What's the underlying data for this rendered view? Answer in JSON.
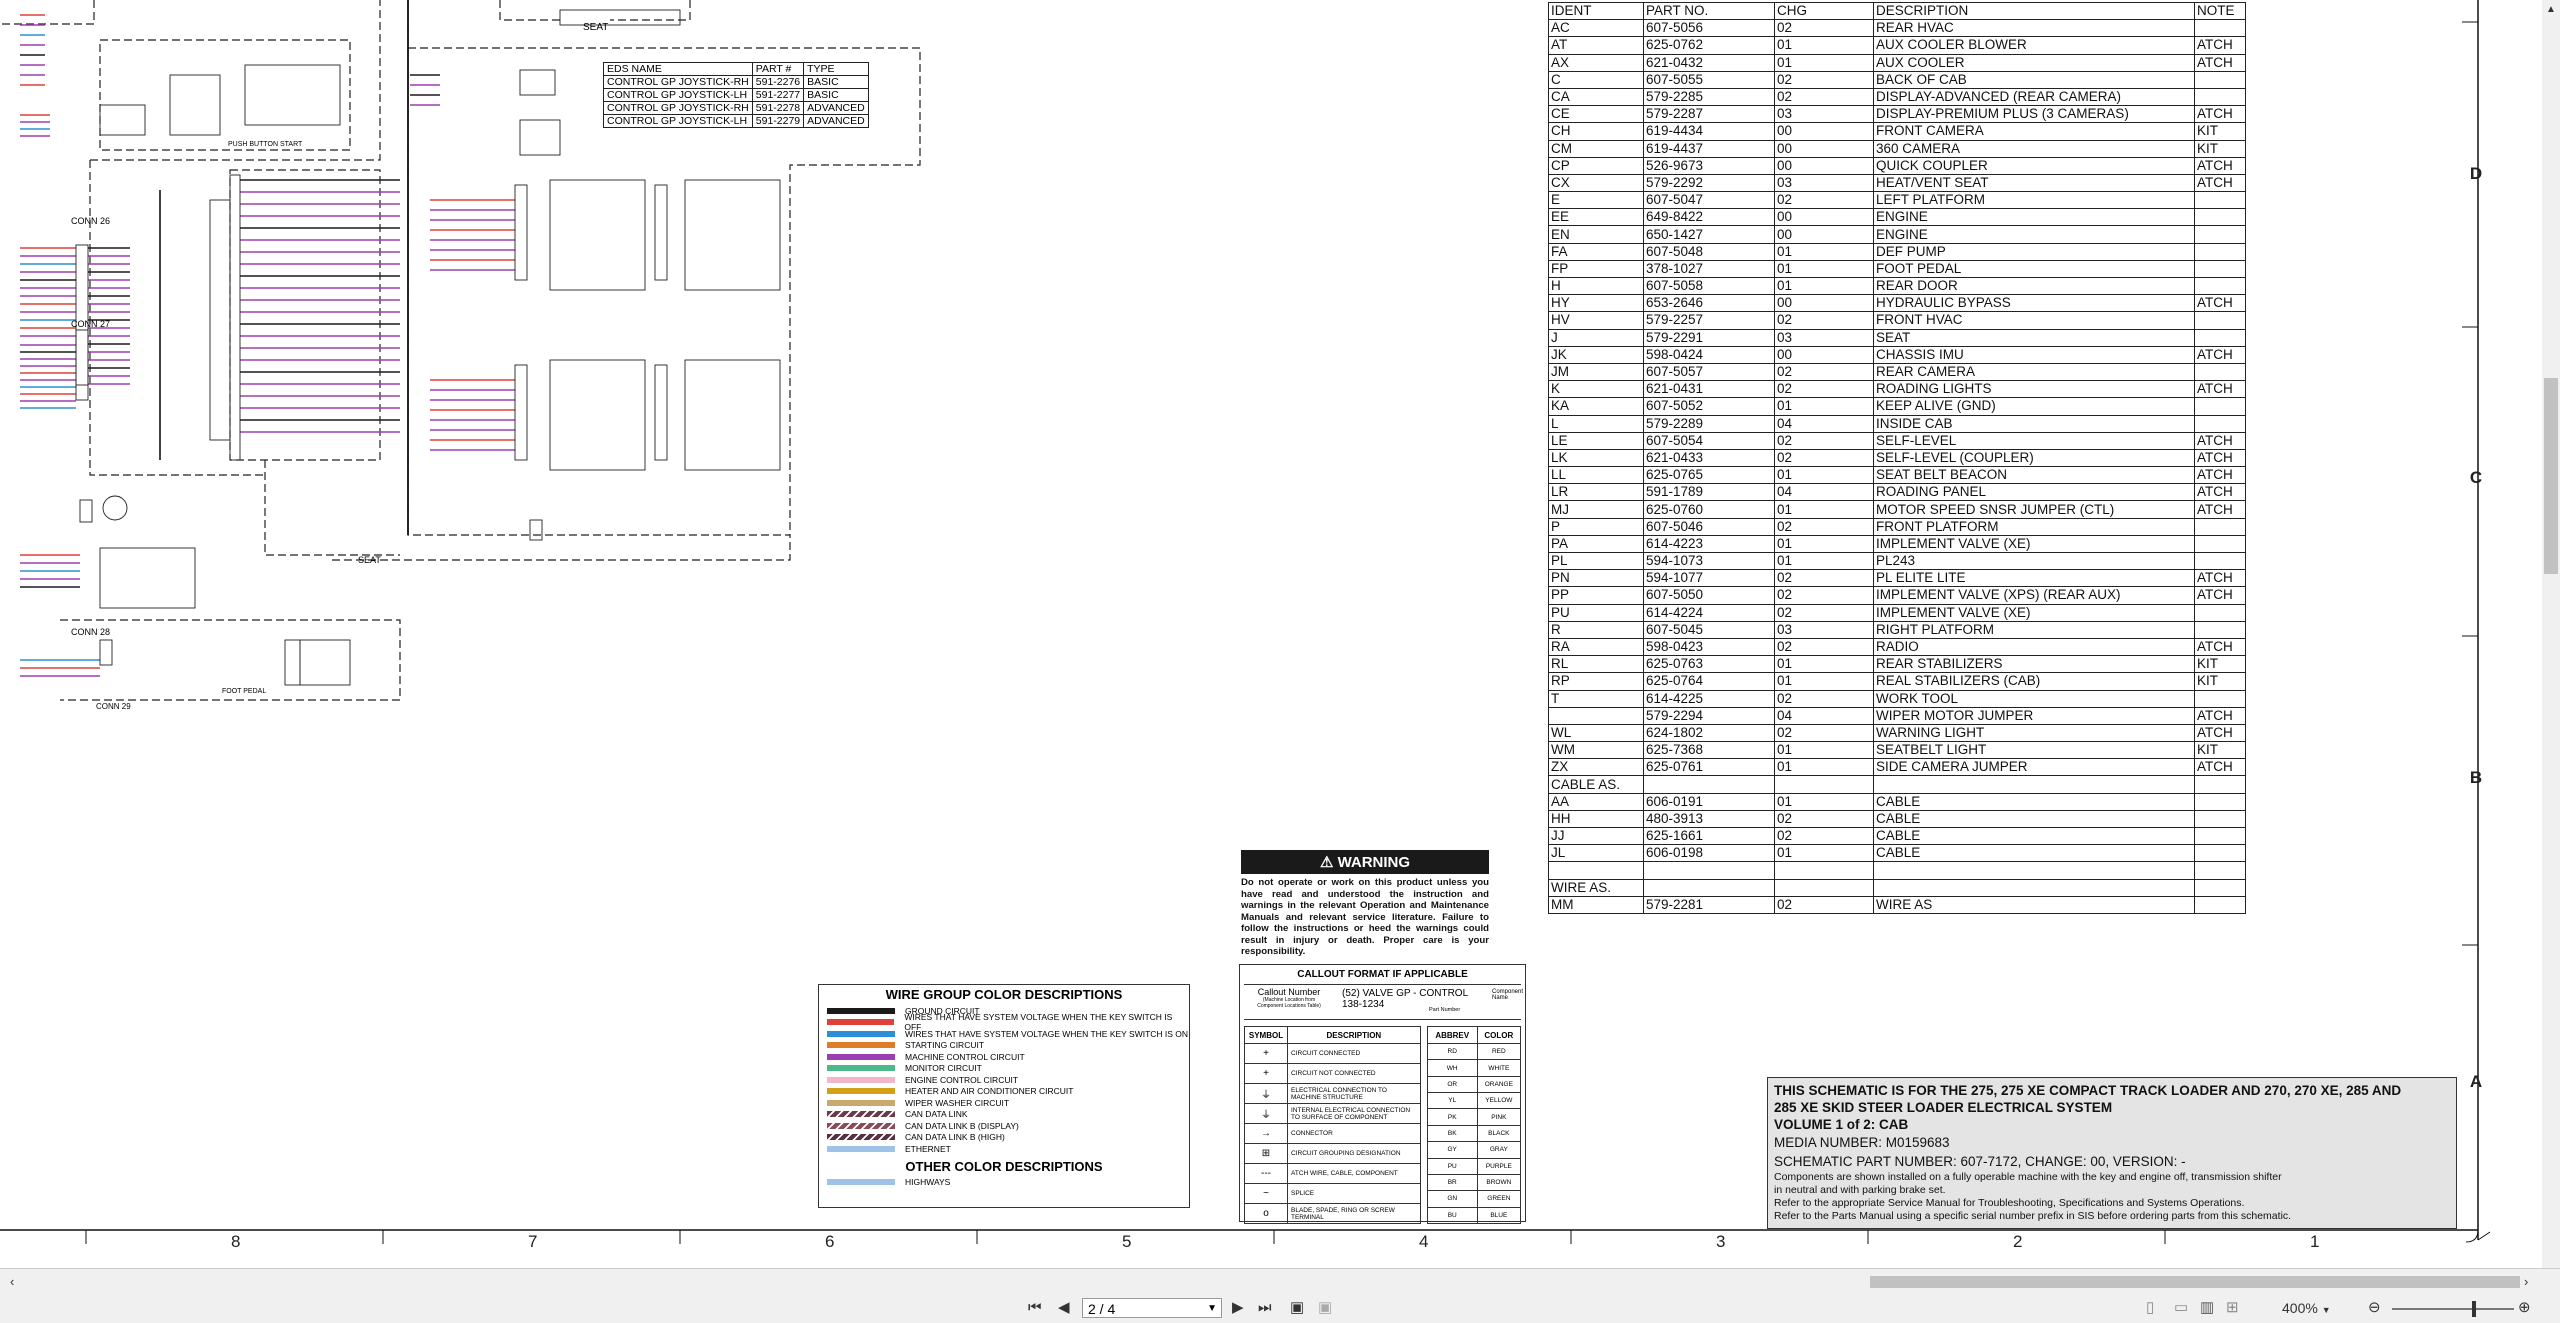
{
  "ident_table": {
    "headers": [
      "IDENT",
      "PART NO.",
      "CHG",
      "DESCRIPTION",
      "NOTE"
    ],
    "rows": [
      [
        "AC",
        "607-5056",
        "02",
        "REAR HVAC",
        ""
      ],
      [
        "AT",
        "625-0762",
        "01",
        "AUX COOLER BLOWER",
        "ATCH"
      ],
      [
        "AX",
        "621-0432",
        "01",
        "AUX COOLER",
        "ATCH"
      ],
      [
        "C",
        "607-5055",
        "02",
        "BACK OF CAB",
        ""
      ],
      [
        "CA",
        "579-2285",
        "02",
        "DISPLAY-ADVANCED (REAR CAMERA)",
        ""
      ],
      [
        "CE",
        "579-2287",
        "03",
        "DISPLAY-PREMIUM PLUS  (3 CAMERAS)",
        "ATCH"
      ],
      [
        "CH",
        "619-4434",
        "00",
        "FRONT CAMERA",
        "KIT"
      ],
      [
        "CM",
        "619-4437",
        "00",
        "360 CAMERA",
        "KIT"
      ],
      [
        "CP",
        "526-9673",
        "00",
        "QUICK COUPLER",
        "ATCH"
      ],
      [
        "CX",
        "579-2292",
        "03",
        "HEAT/VENT SEAT",
        "ATCH"
      ],
      [
        "E",
        "607-5047",
        "02",
        "LEFT PLATFORM",
        ""
      ],
      [
        "EE",
        "649-8422",
        "00",
        "ENGINE",
        ""
      ],
      [
        "EN",
        "650-1427",
        "00",
        "ENGINE",
        ""
      ],
      [
        "FA",
        "607-5048",
        "01",
        "DEF PUMP",
        ""
      ],
      [
        "FP",
        "378-1027",
        "01",
        "FOOT PEDAL",
        ""
      ],
      [
        "H",
        "607-5058",
        "01",
        "REAR DOOR",
        ""
      ],
      [
        "HY",
        "653-2646",
        "00",
        "HYDRAULIC BYPASS",
        "ATCH"
      ],
      [
        "HV",
        "579-2257",
        "02",
        "FRONT HVAC",
        ""
      ],
      [
        "J",
        "579-2291",
        "03",
        "SEAT",
        ""
      ],
      [
        "JK",
        "598-0424",
        "00",
        "CHASSIS IMU",
        "ATCH"
      ],
      [
        "JM",
        "607-5057",
        "02",
        "REAR CAMERA",
        ""
      ],
      [
        "K",
        "621-0431",
        "02",
        "ROADING LIGHTS",
        "ATCH"
      ],
      [
        "KA",
        "607-5052",
        "01",
        "KEEP ALIVE (GND)",
        ""
      ],
      [
        "L",
        "579-2289",
        "04",
        "INSIDE CAB",
        ""
      ],
      [
        "LE",
        "607-5054",
        "02",
        "SELF-LEVEL",
        "ATCH"
      ],
      [
        "LK",
        "621-0433",
        "02",
        "SELF-LEVEL (COUPLER)",
        "ATCH"
      ],
      [
        "LL",
        "625-0765",
        "01",
        "SEAT BELT BEACON",
        "ATCH"
      ],
      [
        "LR",
        "591-1789",
        "04",
        "ROADING PANEL",
        "ATCH"
      ],
      [
        "MJ",
        "625-0760",
        "01",
        "MOTOR SPEED SNSR JUMPER (CTL)",
        "ATCH"
      ],
      [
        "P",
        "607-5046",
        "02",
        "FRONT PLATFORM",
        ""
      ],
      [
        "PA",
        "614-4223",
        "01",
        "IMPLEMENT VALVE (XE)",
        ""
      ],
      [
        "PL",
        "594-1073",
        "01",
        "PL243",
        ""
      ],
      [
        "PN",
        "594-1077",
        "02",
        "PL ELITE LITE",
        "ATCH"
      ],
      [
        "PP",
        "607-5050",
        "02",
        "IMPLEMENT VALVE (XPS) (REAR AUX)",
        "ATCH"
      ],
      [
        "PU",
        "614-4224",
        "02",
        "IMPLEMENT VALVE (XE)",
        ""
      ],
      [
        "R",
        "607-5045",
        "03",
        "RIGHT PLATFORM",
        ""
      ],
      [
        "RA",
        "598-0423",
        "02",
        "RADIO",
        "ATCH"
      ],
      [
        "RL",
        "625-0763",
        "01",
        "REAR STABILIZERS",
        "KIT"
      ],
      [
        "RP",
        "625-0764",
        "01",
        "REAL STABILIZERS (CAB)",
        "KIT"
      ],
      [
        "T",
        "614-4225",
        "02",
        "WORK TOOL",
        ""
      ],
      [
        "",
        "579-2294",
        "04",
        "WIPER MOTOR JUMPER",
        "ATCH"
      ],
      [
        "WL",
        "624-1802",
        "02",
        "WARNING LIGHT",
        "ATCH"
      ],
      [
        "WM",
        "625-7368",
        "01",
        "SEATBELT LIGHT",
        "KIT"
      ],
      [
        "ZX",
        "625-0761",
        "01",
        "SIDE CAMERA JUMPER",
        "ATCH"
      ],
      [
        "CABLE AS.",
        "",
        "",
        "",
        ""
      ],
      [
        "AA",
        "606-0191",
        "01",
        "CABLE",
        ""
      ],
      [
        "HH",
        "480-3913",
        "02",
        "CABLE",
        ""
      ],
      [
        "JJ",
        "625-1661",
        "02",
        "CABLE",
        ""
      ],
      [
        "JL",
        "606-0198",
        "01",
        "CABLE",
        ""
      ],
      [
        "",
        "",
        "",
        "",
        ""
      ],
      [
        "WIRE AS.",
        "",
        "",
        "",
        ""
      ],
      [
        "MM",
        "579-2281",
        "02",
        "WIRE AS",
        ""
      ]
    ]
  },
  "eds_table": {
    "headers": [
      "EDS NAME",
      "PART #",
      "TYPE"
    ],
    "rows": [
      [
        "CONTROL GP JOYSTICK-RH",
        "591-2276",
        "BASIC"
      ],
      [
        "CONTROL GP JOYSTICK-LH",
        "591-2277",
        "BASIC"
      ],
      [
        "CONTROL GP JOYSTICK-RH",
        "591-2278",
        "ADVANCED"
      ],
      [
        "CONTROL GP JOYSTICK-LH",
        "591-2279",
        "ADVANCED"
      ]
    ]
  },
  "schematic_labels": {
    "seat_top": "SEAT",
    "seat_bottom": "SEAT",
    "conn26": "CONN 26",
    "conn27": "CONN 27",
    "conn28": "CONN 28",
    "conn29": "CONN 29",
    "push_button_start": "PUSH BUTTON START",
    "foot_pedal": "FOOT PEDAL"
  },
  "warning": {
    "title": "WARNING",
    "text": "Do not operate or work on this product unless you have read and understood the instruction and warnings in the relevant Operation and Maintenance Manuals and relevant service literature. Failure to follow the instructions or heed the warnings could result in injury or death. Proper care is your responsibility."
  },
  "wire_groups": {
    "title": "WIRE GROUP COLOR DESCRIPTIONS",
    "items": [
      {
        "label": "GROUND CIRCUIT",
        "color": "#1a1a1a"
      },
      {
        "label": "WIRES THAT HAVE SYSTEM VOLTAGE WHEN THE KEY SWITCH IS OFF",
        "color": "#e0403a"
      },
      {
        "label": "WIRES THAT HAVE SYSTEM VOLTAGE WHEN THE KEY SWITCH IS ON",
        "color": "#2c8fd6"
      },
      {
        "label": "STARTING CIRCUIT",
        "color": "#e07b2a"
      },
      {
        "label": "MACHINE CONTROL CIRCUIT",
        "color": "#9b3fb0"
      },
      {
        "label": "MONITOR CIRCUIT",
        "color": "#4db88a"
      },
      {
        "label": "ENGINE CONTROL CIRCUIT",
        "color": "#f1b6c7"
      },
      {
        "label": "HEATER AND AIR CONDITIONER CIRCUIT",
        "color": "#d4a017"
      },
      {
        "label": "WIPER WASHER CIRCUIT",
        "color": "#c9a96e"
      },
      {
        "label": "CAN DATA LINK",
        "color": "#6b3a4a"
      },
      {
        "label": "CAN DATA LINK B (DISPLAY)",
        "color": "#8b4a5a"
      },
      {
        "label": "CAN DATA LINK B (HIGH)",
        "color": "#5a3040"
      },
      {
        "label": "ETHERNET",
        "color": "#9ec3e6"
      }
    ],
    "other_title": "OTHER COLOR DESCRIPTIONS",
    "other_items": [
      {
        "label": "HIGHWAYS",
        "color": "#9ec3e6"
      }
    ]
  },
  "callout": {
    "title": "CALLOUT FORMAT IF APPLICABLE",
    "callout_number": "Callout Number",
    "callout_sub": "(Machine Location from Component Locations Table)",
    "example_line1": "(52) VALVE GP - CONTROL",
    "example_line2": "138-1234",
    "component_name": "Component Name",
    "part_number": "Part Number",
    "symbol_headers": [
      "SYMBOL",
      "DESCRIPTION"
    ],
    "symbols": [
      {
        "sym": "+",
        "desc": "CIRCUIT CONNECTED"
      },
      {
        "sym": "+",
        "desc": "CIRCUIT NOT CONNECTED"
      },
      {
        "sym": "⏚",
        "desc": "ELECTRICAL CONNECTION TO MACHINE STRUCTURE"
      },
      {
        "sym": "⏚",
        "desc": "INTERNAL ELECTRICAL CONNECTION TO SURFACE OF COMPONENT"
      },
      {
        "sym": "→",
        "desc": "CONNECTOR"
      },
      {
        "sym": "⊞",
        "desc": "CIRCUIT GROUPING DESIGNATION"
      },
      {
        "sym": "---",
        "desc": "ATCH WIRE, CABLE, COMPONENT"
      },
      {
        "sym": "~",
        "desc": "SPLICE"
      },
      {
        "sym": "o",
        "desc": "BLADE, SPADE, RING OR SCREW TERMINAL"
      }
    ],
    "abbrev_headers": [
      "ABBREV",
      "COLOR"
    ],
    "abbrevs": [
      [
        "RD",
        "RED"
      ],
      [
        "WH",
        "WHITE"
      ],
      [
        "OR",
        "ORANGE"
      ],
      [
        "YL",
        "YELLOW"
      ],
      [
        "PK",
        "PINK"
      ],
      [
        "BK",
        "BLACK"
      ],
      [
        "GY",
        "GRAY"
      ],
      [
        "PU",
        "PURPLE"
      ],
      [
        "BR",
        "BROWN"
      ],
      [
        "GN",
        "GREEN"
      ],
      [
        "BU",
        "BLUE"
      ]
    ]
  },
  "title_block": {
    "line1": "THIS SCHEMATIC IS FOR THE 275, 275 XE COMPACT TRACK LOADER AND 270, 270 XE, 285 AND",
    "line2": "285 XE SKID STEER LOADER ELECTRICAL SYSTEM",
    "line3": "VOLUME 1 of 2: CAB",
    "media": "MEDIA NUMBER: M0159683",
    "part": "SCHEMATIC PART NUMBER: 607-7172, CHANGE: 00, VERSION: -",
    "note1": "Components are shown installed on a fully operable machine with the key and engine off, transmission shifter",
    "note2": "in neutral and with parking brake set.",
    "note3": "Refer to the appropriate Service Manual for Troubleshooting, Specifications and Systems Operations.",
    "note4": "Refer to the Parts Manual using a specific serial number prefix in SIS before ordering parts from this schematic."
  },
  "grid": {
    "rows": [
      "D",
      "C",
      "B",
      "A"
    ],
    "cols": [
      "8",
      "7",
      "6",
      "5",
      "4",
      "3",
      "2",
      "1"
    ]
  },
  "viewer": {
    "page_value": "2 / 4",
    "zoom": "400%",
    "first_icon": "first-page-icon",
    "prev_icon": "prev-page-icon",
    "next_icon": "next-page-icon",
    "last_icon": "last-page-icon"
  }
}
